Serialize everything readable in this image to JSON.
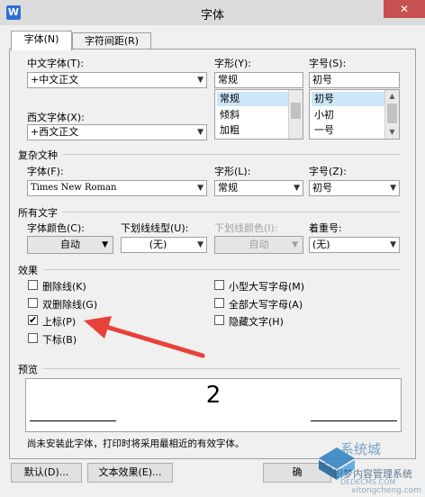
{
  "window": {
    "title": "字体",
    "close": "✕",
    "app_icon": "W"
  },
  "tabs": [
    "字体(N)",
    "字符间距(R)"
  ],
  "chinese_font": {
    "label": "中文字体(T):",
    "value": "+中文正文"
  },
  "western_font": {
    "label": "西文字体(X):",
    "value": "+西文正文"
  },
  "style": {
    "label": "字形(Y):",
    "value": "常规",
    "options": [
      "常规",
      "倾斜",
      "加粗"
    ]
  },
  "size": {
    "label": "字号(S):",
    "value": "初号",
    "options": [
      "初号",
      "小初",
      "一号"
    ]
  },
  "complex": {
    "section": "复杂文种",
    "font_label": "字体(F):",
    "font_value": "Times New Roman",
    "style_label": "字形(L):",
    "style_value": "常规",
    "size_label": "字号(Z):",
    "size_value": "初号"
  },
  "all_text": {
    "section": "所有文字",
    "color_label": "字体颜色(C):",
    "color_value": "自动",
    "underline_type_label": "下划线线型(U):",
    "underline_type_value": "(无)",
    "underline_color_label": "下划线颜色(I):",
    "underline_color_value": "自动",
    "emphasis_label": "着重号:",
    "emphasis_value": "(无)"
  },
  "effects": {
    "section": "效果",
    "items": [
      {
        "label": "删除线(K)",
        "checked": false
      },
      {
        "label": "双删除线(G)",
        "checked": false
      },
      {
        "label": "上标(P)",
        "checked": true
      },
      {
        "label": "下标(B)",
        "checked": false
      },
      {
        "label": "小型大写字母(M)",
        "checked": false
      },
      {
        "label": "全部大写字母(A)",
        "checked": false
      },
      {
        "label": "隐藏文字(H)",
        "checked": false
      }
    ]
  },
  "preview": {
    "section": "预览",
    "sample": "2",
    "note": "尚未安装此字体，打印时将采用最相近的有效字体。"
  },
  "buttons": {
    "default": "默认(D)...",
    "text_effects": "文本效果(E)...",
    "ok": "确"
  },
  "check_mark": "✔",
  "arrow_glyph": "▼",
  "watermark": {
    "line1": "织梦内容管理系统",
    "line2": "DEDECMS.COM",
    "line3": "xitongcheng.com",
    "brand": "系统城"
  },
  "colors": {
    "annotation_arrow": "#e8413a",
    "selection": "#cde6f7",
    "close": "#c75050"
  }
}
